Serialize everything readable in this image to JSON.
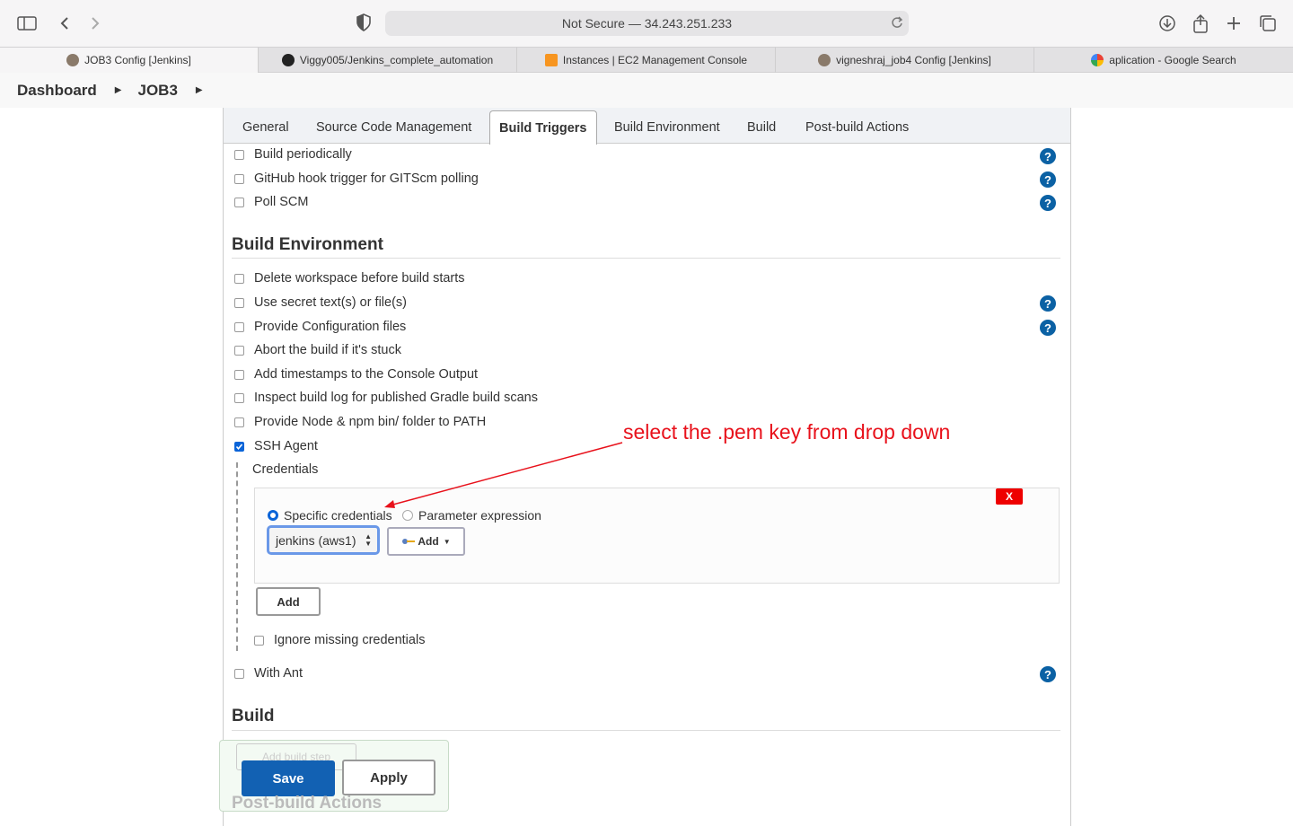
{
  "browser": {
    "address": "Not Secure — 34.243.251.233",
    "tabs": [
      {
        "label": "JOB3 Config [Jenkins]"
      },
      {
        "label": "Viggy005/Jenkins_complete_automation"
      },
      {
        "label": "Instances | EC2 Management Console"
      },
      {
        "label": "vigneshraj_job4 Config [Jenkins]"
      },
      {
        "label": "aplication - Google Search"
      }
    ]
  },
  "breadcrumb": {
    "dashboard": "Dashboard",
    "job": "JOB3"
  },
  "config_tabs": [
    "General",
    "Source Code Management",
    "Build Triggers",
    "Build Environment",
    "Build",
    "Post-build Actions"
  ],
  "triggers": [
    "Build periodically",
    "GitHub hook trigger for GITScm polling",
    "Poll SCM"
  ],
  "build_env": {
    "title": "Build Environment",
    "items": [
      "Delete workspace before build starts",
      "Use secret text(s) or file(s)",
      "Provide Configuration files",
      "Abort the build if it's stuck",
      "Add timestamps to the Console Output",
      "Inspect build log for published Gradle build scans",
      "Provide Node & npm bin/ folder to PATH",
      "SSH Agent"
    ],
    "credentials_label": "Credentials",
    "specific_credentials": "Specific credentials",
    "parameter_expression": "Parameter expression",
    "selected_credential": "jenkins (aws1)",
    "add_dropdown": "Add",
    "remove": "X",
    "add_button": "Add",
    "ignore_missing": "Ignore missing credentials",
    "with_ant": "With Ant"
  },
  "build": {
    "title": "Build",
    "add_step": "Add build step"
  },
  "post_build": {
    "title": "Post-build Actions"
  },
  "actions": {
    "save": "Save",
    "apply": "Apply"
  },
  "annotation": "select the .pem key from drop down",
  "help": "?"
}
